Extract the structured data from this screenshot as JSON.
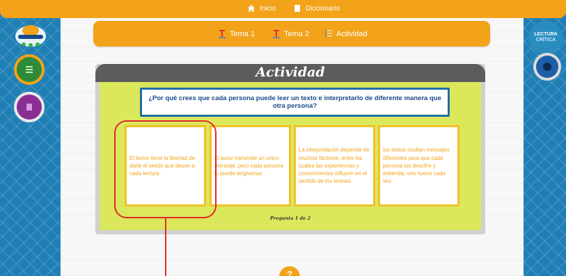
{
  "topbar": {
    "home_label": "Inicio",
    "dictionary_label": "Diccionario"
  },
  "tabs": [
    {
      "label": "Tema 1"
    },
    {
      "label": "Tema 2"
    },
    {
      "label": "Actividad"
    }
  ],
  "right_panel": {
    "badge_line1": "LECTURA",
    "badge_line2": "CRÍTICA"
  },
  "activity": {
    "title": "Actividad",
    "question": "¿Por qué crees que cada persona puede leer un texto e interpretarlo de diferente manera que otra persona?",
    "options": [
      "El lector tiene la libertad de darle el setido que desee a cada lectura",
      "El autor transmite un unico mensaje, pero cada persona lo puede tergiversar",
      "La interpretación depende de muchos factores, entre los cuales las experiencias y conocimientos influyen en el sentido de los textoss",
      "los textos ocultan mensajes diferentes para que cada persona los descifre y entienda, uno nuevo cada vez"
    ],
    "pager": "Pregunta 1 de 2"
  },
  "help": {
    "label": "?"
  },
  "colors": {
    "accent_orange": "#f2a31a",
    "sidebar_blue": "#1f7fb5",
    "question_border": "#1c6fa4",
    "body_green": "#dbe85c",
    "highlight_red": "#e02a2a"
  }
}
